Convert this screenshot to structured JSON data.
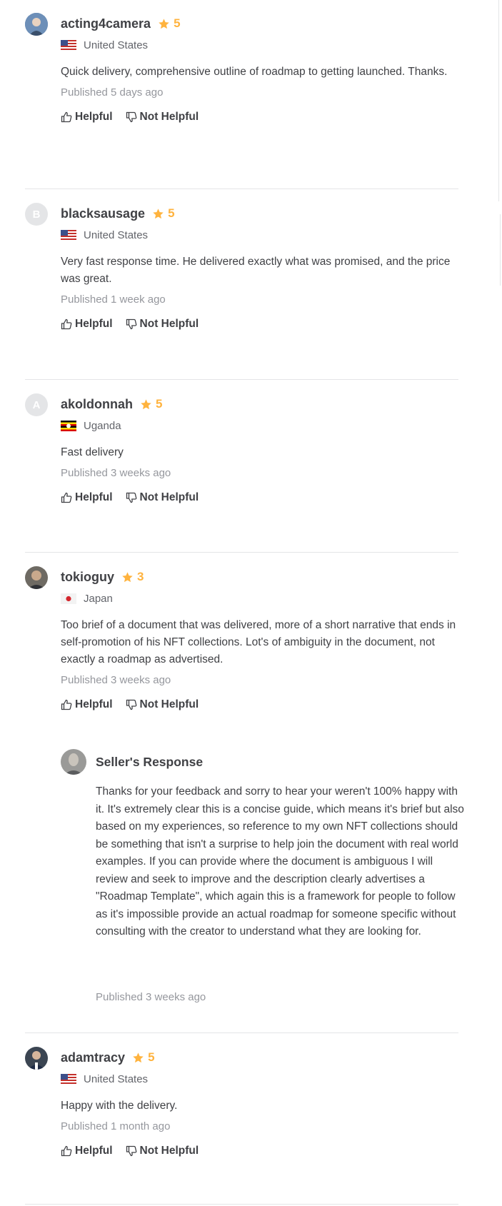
{
  "reviews": [
    {
      "username": "acting4camera",
      "rating": "5",
      "country": "United States",
      "flag": "us-flag",
      "text": "Quick delivery, comprehensive outline of roadmap to getting launched. Thanks.",
      "published": "Published 5 days ago",
      "helpful": "Helpful",
      "not_helpful": "Not Helpful"
    },
    {
      "username": "blacksausage",
      "avatar_letter": "B",
      "rating": "5",
      "country": "United States",
      "flag": "us-flag",
      "text": "Very fast response time. He delivered exactly what was promised, and the price was great.",
      "published": "Published 1 week ago",
      "helpful": "Helpful",
      "not_helpful": "Not Helpful"
    },
    {
      "username": "akoldonnah",
      "avatar_letter": "A",
      "rating": "5",
      "country": "Uganda",
      "flag": "uganda-flag",
      "text": "Fast delivery",
      "published": "Published 3 weeks ago",
      "helpful": "Helpful",
      "not_helpful": "Not Helpful"
    },
    {
      "username": "tokioguy",
      "rating": "3",
      "country": "Japan",
      "flag": "japan-flag",
      "text": "Too brief of a document that was delivered, more of a short narrative that ends in self-promotion of his NFT collections. Lot's of ambiguity in the document, not exactly a roadmap as advertised.",
      "published": "Published 3 weeks ago",
      "helpful": "Helpful",
      "not_helpful": "Not Helpful",
      "seller_response": {
        "title": "Seller's Response",
        "text": "Thanks for your feedback and sorry to hear your weren't 100% happy with it. It's extremely clear this is a concise guide, which means it's brief but also based on my experiences, so reference to my own NFT collections should be something that isn't a surprise to help join the document with real world examples. If you can provide where the document is ambiguous I will review and seek to improve and the description clearly advertises a \"Roadmap Template\", which again this is a framework for people to follow as it's impossible provide an actual roadmap for someone specific without consulting with the creator to understand what they are looking for.",
        "published": "Published 3 weeks ago"
      }
    },
    {
      "username": "adamtracy",
      "rating": "5",
      "country": "United States",
      "flag": "us-flag",
      "text": "Happy with the delivery.",
      "published": "Published 1 month ago",
      "helpful": "Helpful",
      "not_helpful": "Not Helpful"
    }
  ],
  "colors": {
    "star": "#ffb33e",
    "text": "#404145",
    "muted": "#95979d",
    "divider": "#e4e5e7"
  }
}
